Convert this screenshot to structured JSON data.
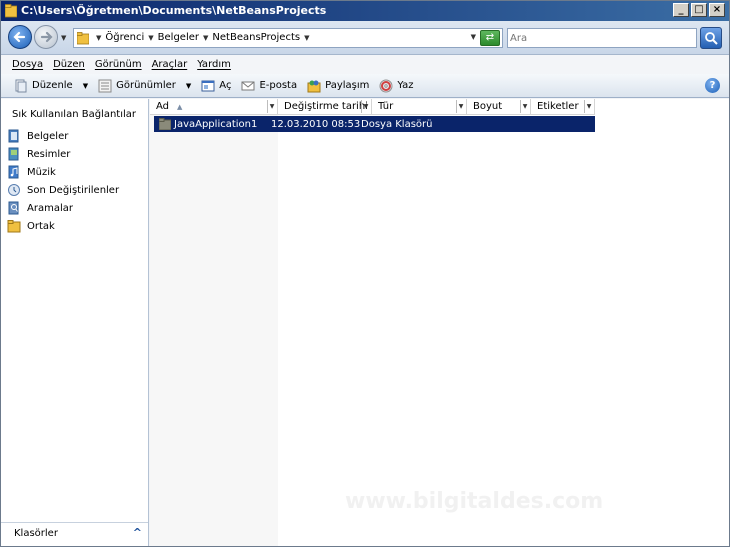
{
  "window": {
    "title": "C:\\Users\\Öğretmen\\Documents\\NetBeansProjects",
    "buttons": {
      "minimize": "_",
      "maximize": "□",
      "close": "×"
    }
  },
  "address": {
    "breadcrumbs": [
      "Öğrenci",
      "Belgeler",
      "NetBeansProjects"
    ],
    "search_placeholder": "Ara"
  },
  "menu": [
    "Dosya",
    "Düzen",
    "Görünüm",
    "Araçlar",
    "Yardım"
  ],
  "toolbar": {
    "organize": "Düzenle",
    "views": "Görünümler",
    "open": "Aç",
    "email": "E-posta",
    "share": "Paylaşım",
    "burn": "Yaz",
    "help": "?"
  },
  "nav": {
    "heading": "Sık Kullanılan Bağlantılar",
    "links": [
      {
        "label": "Belgeler",
        "icon": "documents-icon"
      },
      {
        "label": "Resimler",
        "icon": "pictures-icon"
      },
      {
        "label": "Müzik",
        "icon": "music-icon"
      },
      {
        "label": "Son Değiştirilenler",
        "icon": "recent-icon"
      },
      {
        "label": "Aramalar",
        "icon": "searches-icon"
      },
      {
        "label": "Ortak",
        "icon": "public-folder-icon"
      }
    ],
    "folders_label": "Klasörler"
  },
  "columns": [
    "Ad",
    "Değiştirme tarihi",
    "Tür",
    "Boyut",
    "Etiketler"
  ],
  "files": [
    {
      "name": "JavaApplication1",
      "modified": "12.03.2010 08:53",
      "type": "Dosya Klasörü",
      "size": "",
      "tags": "",
      "selected": true
    }
  ],
  "watermark": "www.bilgitaldes.com",
  "colors": {
    "title_bar": "#0a246a",
    "selection": "#0a246a",
    "folder_yellow": "#f0c040"
  }
}
